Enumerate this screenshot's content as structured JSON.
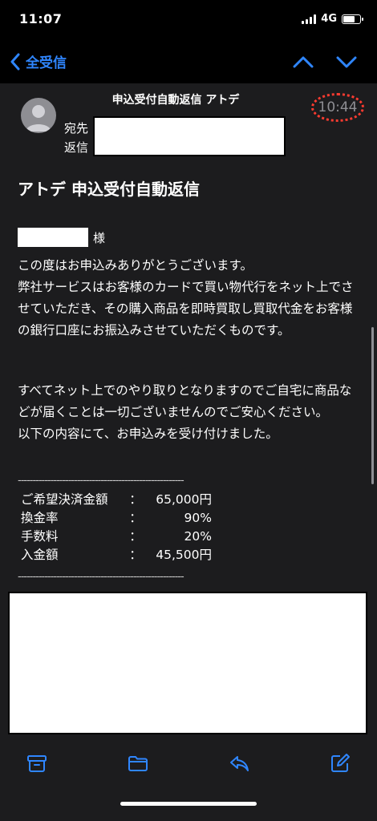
{
  "status_bar": {
    "time": "11:07",
    "network": "4G"
  },
  "nav": {
    "back_label": "全受信"
  },
  "mail": {
    "subject_short": "申込受付自動返信 アトデ",
    "to_label": "宛先",
    "reply_label": "返信",
    "time": "10:44",
    "title": "アトデ 申込受付自動返信",
    "honorific": "様",
    "para1": "この度はお申込みありがとうございます。\n弊社サービスはお客様のカードで買い物代行をネット上でさせていただき、その購入商品を即時買取し買取代金をお客様の銀行口座にお振込みさせていただくものです。",
    "para2": "すべてネット上でのやり取りとなりますのでご自宅に商品などが届くことは一切ございませんのでご安心ください。\n以下の内容にて、お申込みを受け付けました。",
    "divider": "--------------------------------------------------------",
    "fees": [
      {
        "label": "ご希望決済金額",
        "colon": "：",
        "value": "65,000円"
      },
      {
        "label": "換金率",
        "colon": "：",
        "value": "90%"
      },
      {
        "label": "手数料",
        "colon": "：",
        "value": "20%"
      },
      {
        "label": "入金額",
        "colon": "：",
        "value": "45,500円"
      }
    ]
  },
  "toolbar": {
    "icons": [
      "archive-icon",
      "folder-icon",
      "reply-icon",
      "compose-icon"
    ]
  },
  "colors": {
    "accent": "#2f86ff",
    "highlight": "#ff3b30",
    "background": "#1c1c1e"
  }
}
